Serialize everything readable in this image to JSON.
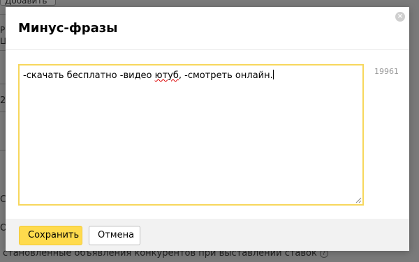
{
  "background": {
    "add_button": "Добавить",
    "fragment_1": "Ра",
    "fragment_2": "Це",
    "fragment_3": "2",
    "fragment_4": "Ст",
    "fragment_5": "О",
    "bottom_text": "становленные объявления конкурентов при выставлении ставок",
    "help_icon": "?"
  },
  "modal": {
    "title": "Минус-фразы",
    "close_icon": "×",
    "text_before": "-скачать бесплатно -видео ",
    "text_misspelled": "ютуб",
    "text_after": ", -смотреть онлайн.",
    "char_counter": "19961",
    "save_label": "Сохранить",
    "cancel_label": "Отмена"
  },
  "colors": {
    "accent_yellow": "#ffdb4d",
    "focus_border": "#f7d75c",
    "footer_bg": "#f2f2f2",
    "overlay": "#7a7a7a"
  }
}
